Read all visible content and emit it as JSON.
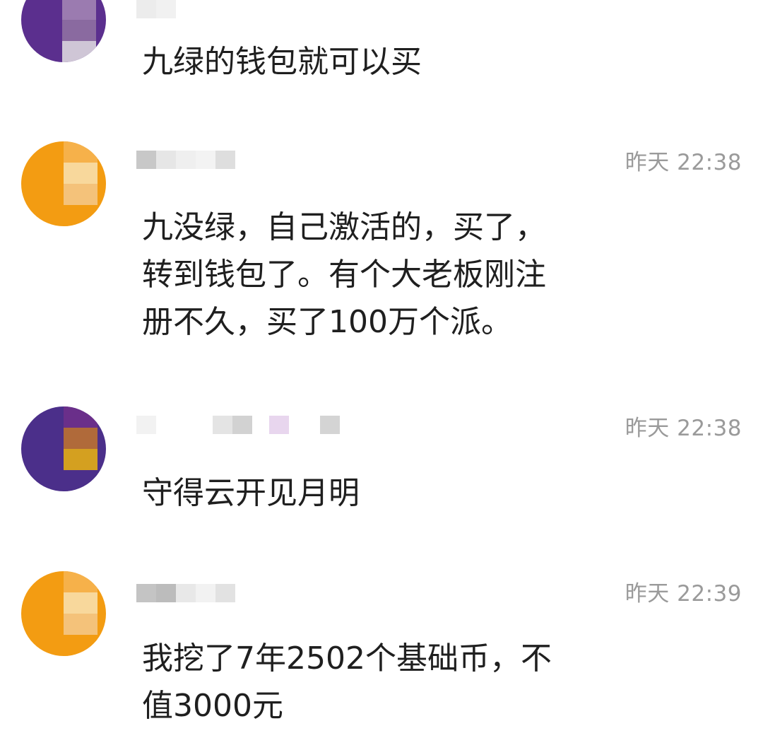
{
  "colors": {
    "avatar_purple": "#5b2f8e",
    "avatar_orange": "#f39c12",
    "timestamp": "#9a9a9a",
    "text": "#1f1f1f"
  },
  "comments": [
    {
      "text": "九绿的钱包就可以买",
      "timestamp": ""
    },
    {
      "text": "九没绿，自己激活的，买了，\n转到钱包了。有个大老板刚注\n册不久，买了100万个派。",
      "timestamp": "昨天 22:38"
    },
    {
      "text": "守得云开见月明",
      "timestamp": "昨天 22:38"
    },
    {
      "text": "我挖了7年2502个基础币，不\n值3000元",
      "timestamp": "昨天 22:39"
    }
  ]
}
